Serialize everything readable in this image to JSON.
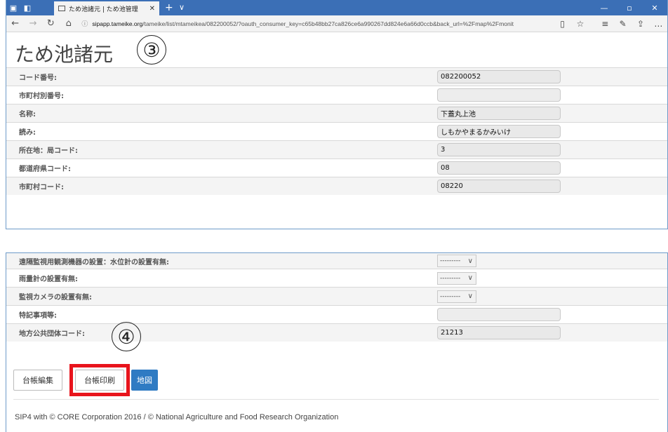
{
  "browser": {
    "tab_title": "ため池諸元 | ため池管理",
    "tab_close": "✕",
    "new_tab": "+",
    "tab_dropdown": "∨",
    "window_controls": [
      "—",
      "▫",
      "✕"
    ],
    "url_host": "sipapp.tameike.org",
    "url_path": "/tameike/list/mtameikea/082200052/?oauth_consumer_key=c65b48bb27ca826ce6a990267dd824e6a66d0ccb&back_url=%2Fmap%2Fmonit"
  },
  "page_title": "ため池諸元",
  "markers": {
    "three": "③",
    "four": "④"
  },
  "top_rows": [
    {
      "label": "コード番号:",
      "value": "082200052"
    },
    {
      "label": "市町村別番号:",
      "value": ""
    },
    {
      "label": "名称:",
      "value": "下蓋丸上池"
    },
    {
      "label": "読み:",
      "value": "しもかやまるかみいけ"
    },
    {
      "label": "所在地：局コード:",
      "value": "3"
    },
    {
      "label": "都道府県コード:",
      "value": "08"
    },
    {
      "label": "市町村コード:",
      "value": "08220"
    }
  ],
  "bottom_rows": [
    {
      "label": "遠隔監視用観測機器の設置：水位計の設置有無:",
      "select": "---------"
    },
    {
      "label": "雨量計の設置有無:",
      "select": "---------"
    },
    {
      "label": "監視カメラの設置有無:",
      "select": "---------"
    },
    {
      "label": "特記事項等:",
      "value": ""
    },
    {
      "label": "地方公共団体コード:",
      "value": "21213"
    }
  ],
  "buttons": {
    "edit": "台帳編集",
    "print": "台帳印刷",
    "map": "地図"
  },
  "footer": "SIP4 with © CORE Corporation 2016 / © National Agriculture and Food Research Organization",
  "colors": {
    "titlebar": "#3b6fb6",
    "highlight": "#e8141c",
    "map_button": "#2f7bc3"
  }
}
